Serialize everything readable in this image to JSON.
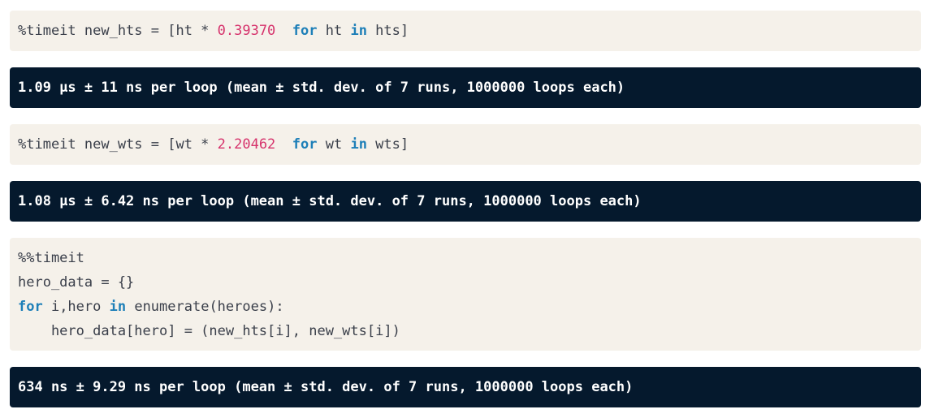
{
  "cells": [
    {
      "type": "code",
      "lines": [
        [
          {
            "t": "%timeit new_hts = [ht * "
          },
          {
            "t": "0.39370",
            "c": "num"
          },
          {
            "t": "  "
          },
          {
            "t": "for",
            "c": "kw"
          },
          {
            "t": " ht "
          },
          {
            "t": "in",
            "c": "kw"
          },
          {
            "t": " hts]"
          }
        ]
      ]
    },
    {
      "type": "output",
      "text": "1.09 µs ± 11 ns per loop (mean ± std. dev. of 7 runs, 1000000 loops each)"
    },
    {
      "type": "code",
      "lines": [
        [
          {
            "t": "%timeit new_wts = [wt * "
          },
          {
            "t": "2.20462",
            "c": "num"
          },
          {
            "t": "  "
          },
          {
            "t": "for",
            "c": "kw"
          },
          {
            "t": " wt "
          },
          {
            "t": "in",
            "c": "kw"
          },
          {
            "t": " wts]"
          }
        ]
      ]
    },
    {
      "type": "output",
      "text": "1.08 µs ± 6.42 ns per loop (mean ± std. dev. of 7 runs, 1000000 loops each)"
    },
    {
      "type": "code",
      "lines": [
        [
          {
            "t": "%%timeit"
          }
        ],
        [
          {
            "t": "hero_data = {}"
          }
        ],
        [
          {
            "t": "for",
            "c": "kw"
          },
          {
            "t": " i,hero "
          },
          {
            "t": "in",
            "c": "kw"
          },
          {
            "t": " enumerate(heroes):"
          }
        ],
        [
          {
            "t": "    hero_data[hero] = (new_hts[i], new_wts[i])"
          }
        ]
      ]
    },
    {
      "type": "output",
      "text": "634 ns ± 9.29 ns per loop (mean ± std. dev. of 7 runs, 1000000 loops each)"
    }
  ],
  "colors": {
    "code_background": "#f5f1ea",
    "output_background": "#05192d",
    "keyword": "#1d7fb8",
    "number": "#d6336c"
  }
}
